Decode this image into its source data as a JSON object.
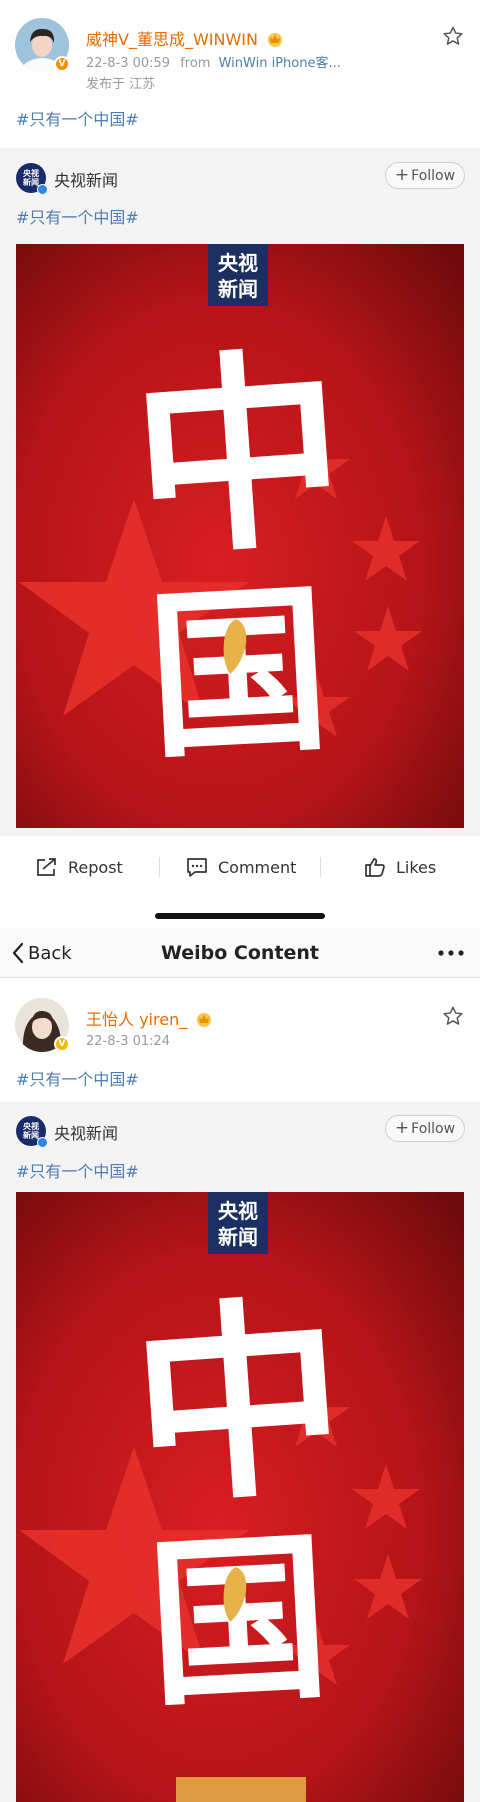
{
  "post1": {
    "username": "威神V_董思成_WINWIN",
    "time": "22-8-3 00:59",
    "from_label": "from",
    "source": "WinWin iPhone客...",
    "location": "发布于 江苏",
    "hashtag": "#只有一个中国#",
    "badge": "V"
  },
  "repost1": {
    "author": "央视新闻",
    "avatar_text_top": "央视",
    "avatar_text_bottom": "新闻",
    "follow_label": "Follow",
    "hashtag": "#只有一个中国#",
    "poster_logo_top": "央视",
    "poster_logo_bottom": "新闻",
    "poster_char_1": "中",
    "poster_char_2": "国"
  },
  "actions": {
    "repost_label": "Repost",
    "comment_label": "Comment",
    "likes_label": "Likes"
  },
  "navbar": {
    "back_label": "Back",
    "title": "Weibo Content"
  },
  "post2": {
    "username": "王怡人 yiren_",
    "time": "22-8-3 01:24",
    "hashtag": "#只有一个中国#",
    "badge": "V"
  },
  "repost2": {
    "author": "央视新闻",
    "avatar_text_top": "央视",
    "avatar_text_bottom": "新闻",
    "follow_label": "Follow",
    "hashtag": "#只有一个中国#",
    "poster_logo_top": "央视",
    "poster_logo_bottom": "新闻",
    "poster_char_1": "中",
    "poster_char_2": "国"
  },
  "icons": {
    "star": "star-icon",
    "crown": "crown-icon",
    "repost": "repost-icon",
    "comment": "comment-icon",
    "like": "thumbs-up-icon",
    "back": "chevron-left-icon",
    "more": "more-dots-icon"
  },
  "colors": {
    "username": "#e86c00",
    "link": "#507daf",
    "poster_red": "#c4161c",
    "star_red": "#e5302b",
    "cctv_blue": "#1a2b6b"
  }
}
